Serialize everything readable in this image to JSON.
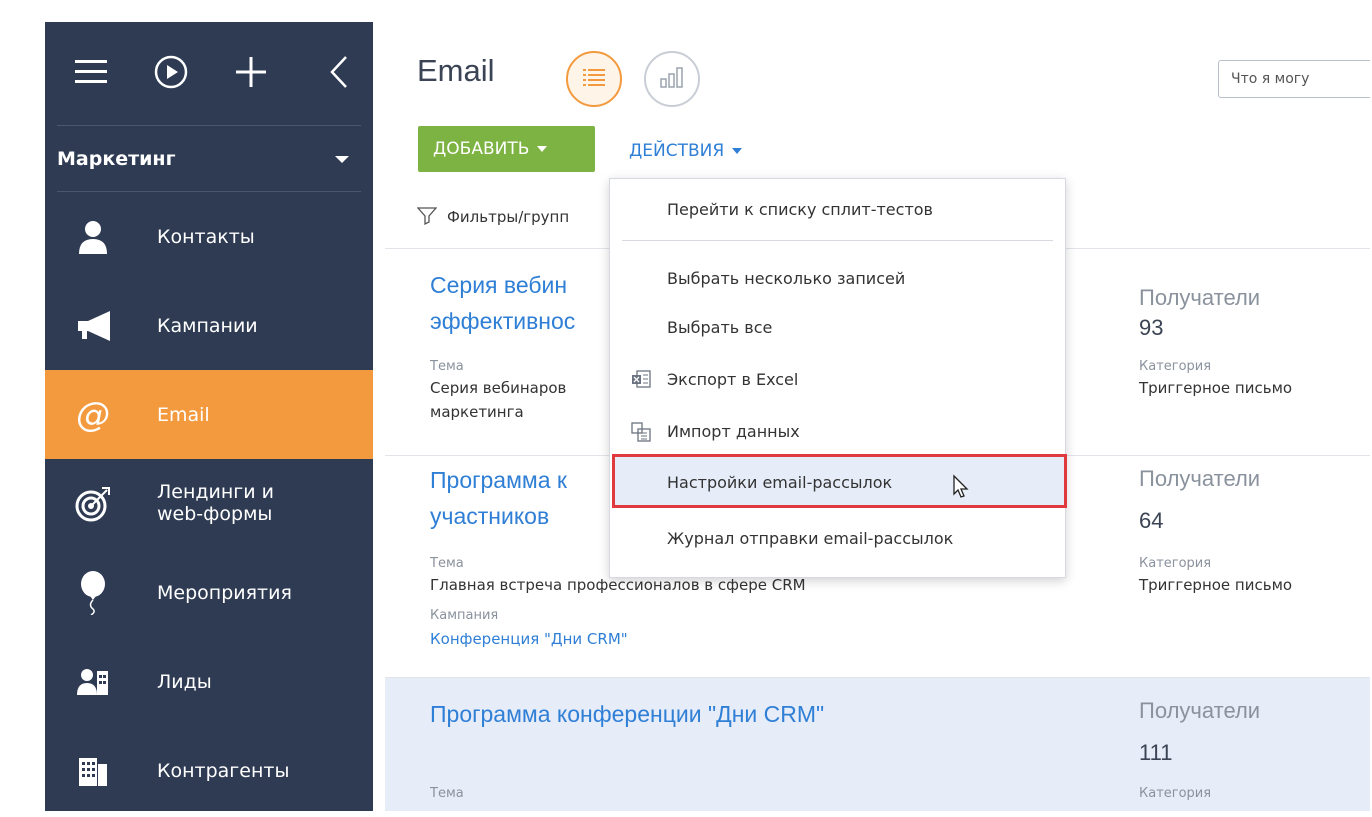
{
  "sidebar": {
    "section": "Маркетинг",
    "items": [
      {
        "label": "Контакты",
        "icon": "person-icon"
      },
      {
        "label": "Кампании",
        "icon": "megaphone-icon"
      },
      {
        "label": "Email",
        "icon": "at-icon",
        "active": true
      },
      {
        "label": "Лендинги и",
        "label2": "web-формы",
        "icon": "target-icon"
      },
      {
        "label": "Мероприятия",
        "icon": "balloon-icon"
      },
      {
        "label": "Лиды",
        "icon": "leads-icon"
      },
      {
        "label": "Контрагенты",
        "icon": "building-icon"
      }
    ]
  },
  "header": {
    "title": "Email",
    "search_placeholder": "Что я могу"
  },
  "toolbar": {
    "add_label": "ДОБАВИТЬ",
    "actions_label": "ДЕЙСТВИЯ",
    "filters_label": "Фильтры/групп"
  },
  "records": [
    {
      "title_line1": "Серия вебин",
      "title_line2": "эффективнос",
      "topic_label": "Тема",
      "topic_line1": "Серия вебинаров",
      "topic_line2": "маркетинга",
      "recipients_label": "Получатели",
      "recipients": "93",
      "category_label": "Категория",
      "category": "Триггерное письмо"
    },
    {
      "title_line1": "Программа к",
      "title_line2": "участников",
      "topic_label": "Тема",
      "topic_line1": "Главная встреча профессионалов в сфере CRM",
      "campaign_label": "Кампания",
      "campaign": "Конференция \"Дни CRM\"",
      "recipients_label": "Получатели",
      "recipients": "64",
      "category_label": "Категория",
      "category": "Триггерное письмо"
    },
    {
      "title_line1": "Программа конференции \"Дни CRM\"",
      "topic_label": "Тема",
      "recipients_label": "Получатели",
      "recipients": "111",
      "category_label": "Категория"
    }
  ],
  "dropdown": {
    "items": [
      {
        "label": "Перейти к списку сплит-тестов"
      },
      {
        "label": "Выбрать несколько записей"
      },
      {
        "label": "Выбрать все"
      },
      {
        "label": "Экспорт в Excel",
        "icon": "excel-export-icon"
      },
      {
        "label": "Импорт данных",
        "icon": "import-icon"
      },
      {
        "label": "Настройки email-рассылок",
        "highlighted": true
      },
      {
        "label": "Журнал отправки email-рассылок"
      }
    ]
  },
  "colors": {
    "sidebar_bg": "#2e3b53",
    "active_item": "#f39a3f",
    "add_button": "#7cb342",
    "link_blue": "#2f7fd6",
    "highlight_border": "#e0393e",
    "selected_row": "#e6ecf8"
  }
}
